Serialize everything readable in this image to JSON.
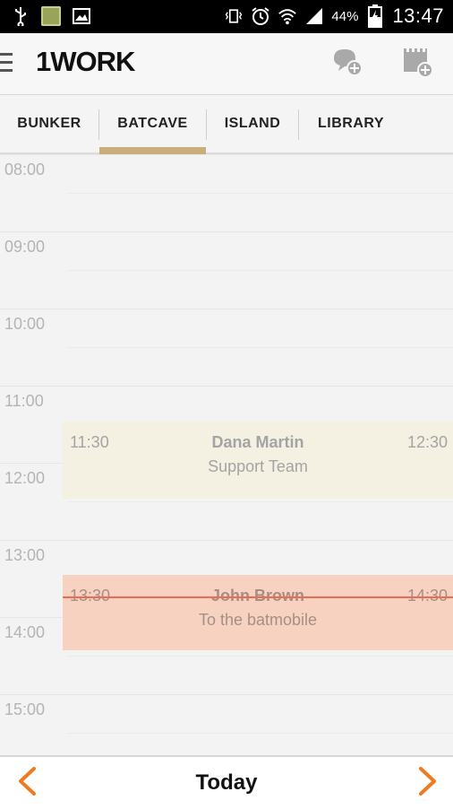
{
  "status_bar": {
    "battery_percent": "44%",
    "time": "13:47",
    "icons": [
      "usb-icon",
      "app-thumbnail-icon",
      "image-icon",
      "vibrate-icon",
      "alarm-icon",
      "wifi-icon",
      "signal-icon",
      "battery-charging-icon"
    ]
  },
  "app_bar": {
    "logo": "1WORK",
    "actions": [
      "new-chat-icon",
      "new-event-icon"
    ]
  },
  "tabs": {
    "items": [
      {
        "label": "BUNKER"
      },
      {
        "label": "BATCAVE"
      },
      {
        "label": "ISLAND"
      },
      {
        "label": "LIBRARY"
      }
    ],
    "selected": "BATCAVE"
  },
  "calendar": {
    "hours": [
      "08:00",
      "09:00",
      "10:00",
      "11:00",
      "12:00",
      "13:00",
      "14:00",
      "15:00"
    ],
    "events": [
      {
        "start": "11:30",
        "end": "12:30",
        "title": "Dana Martin",
        "subtitle": "Support Team"
      },
      {
        "start": "13:30",
        "end": "14:30",
        "title": "John Brown",
        "subtitle": "To the batmobile"
      }
    ],
    "current_time_line": "13:47"
  },
  "bottom_bar": {
    "today_label": "Today"
  },
  "colors": {
    "accent": "#f07a22",
    "tab_indicator": "#c9ad7a",
    "event_default": "#f4f1e2",
    "event_highlight": "#f7d2c0",
    "now_line": "#ee6b5a"
  }
}
